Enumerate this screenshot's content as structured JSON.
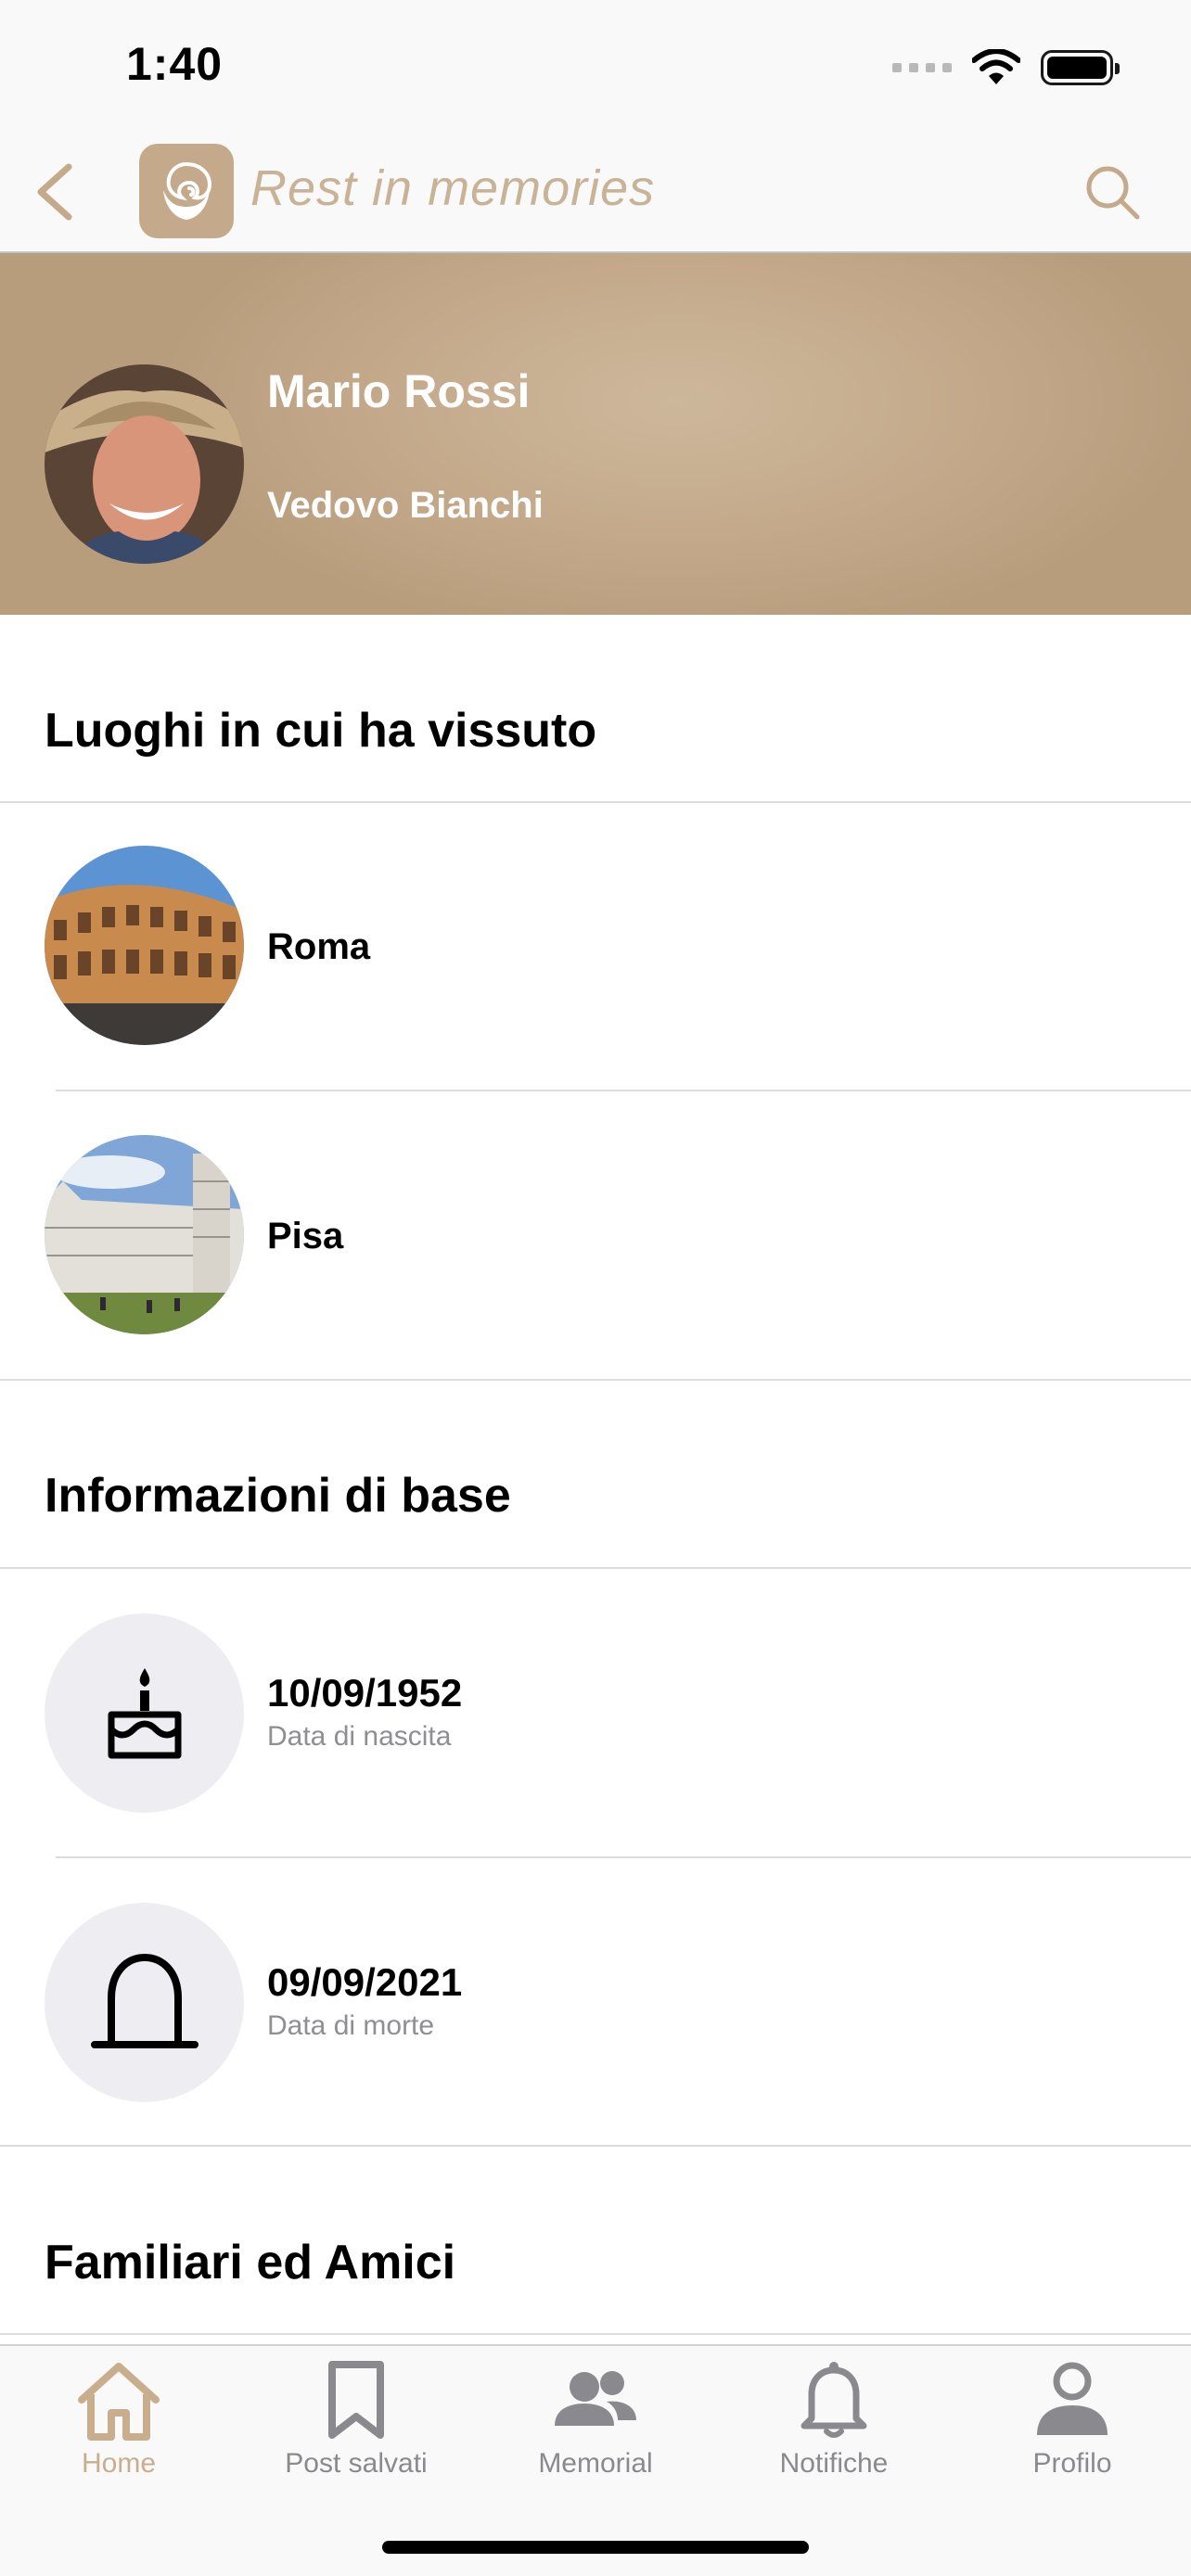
{
  "status_bar": {
    "time": "1:40"
  },
  "nav": {
    "app_title": "Rest in memories"
  },
  "profile": {
    "name": "Mario Rossi",
    "subtitle": "Vedovo Bianchi"
  },
  "places": {
    "title": "Luoghi in cui ha vissuto",
    "items": [
      {
        "label": "Roma"
      },
      {
        "label": "Pisa"
      }
    ]
  },
  "basic_info": {
    "title": "Informazioni di base",
    "items": [
      {
        "value": "10/09/1952",
        "caption": "Data di nascita",
        "icon": "cake-icon"
      },
      {
        "value": "09/09/2021",
        "caption": "Data di morte",
        "icon": "tombstone-icon"
      }
    ]
  },
  "family": {
    "title": "Familiari ed Amici"
  },
  "tab_bar": {
    "active": "home",
    "tabs": [
      {
        "label": "Home",
        "icon": "home-icon"
      },
      {
        "label": "Post salvati",
        "icon": "bookmark-icon"
      },
      {
        "label": "Memorial",
        "icon": "people-icon"
      },
      {
        "label": "Notifiche",
        "icon": "bell-icon"
      },
      {
        "label": "Profilo",
        "icon": "person-icon"
      }
    ]
  },
  "colors": {
    "accent": "#c4aa8b",
    "title_tint": "#c9b397",
    "tab_inactive": "#8a8a8e",
    "icon_bg": "#eeeef2"
  }
}
